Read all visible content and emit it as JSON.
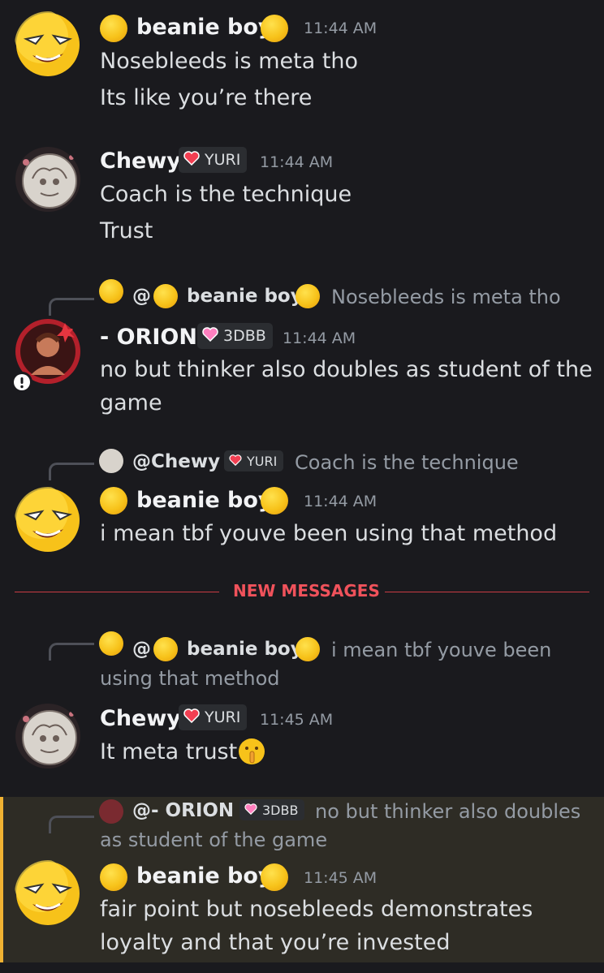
{
  "messages": [
    {
      "author": "beanie boy",
      "time": "11:44 AM",
      "lines": [
        "Nosebleeds is meta tho",
        "Its like you’re there"
      ]
    },
    {
      "author": "Chewy",
      "tag": "YURI",
      "time": "11:44 AM",
      "lines": [
        "Coach is the technique",
        "Trust"
      ]
    },
    {
      "reply": {
        "mention": "@",
        "name": "beanie boy",
        "text": "Nosebleeds is meta tho"
      },
      "author": "- ORION",
      "tag": "3DBB",
      "time": "11:44 AM",
      "lines": [
        "no but thinker also doubles as student of the",
        "game"
      ]
    },
    {
      "reply": {
        "mention": "@Chewy",
        "tag": "YURI",
        "text": "Coach is the technique"
      },
      "author": "beanie boy",
      "time": "11:44 AM",
      "lines": [
        "i mean tbf youve been using that method"
      ]
    },
    {
      "reply": {
        "mention": "@",
        "name": "beanie boy",
        "text_line1": "i mean tbf youve been",
        "text_line2": "using that method"
      },
      "author": "Chewy",
      "tag": "YURI",
      "time": "11:45 AM",
      "lines": [
        "It meta trust"
      ]
    },
    {
      "reply": {
        "mention": "@- ORION",
        "tag": "3DBB",
        "text_line1": "no but thinker also doubles",
        "text_line2": "as student of the game"
      },
      "author": "beanie boy",
      "time": "11:45 AM",
      "lines": [
        "fair point but nosebleeds demonstrates",
        "loyalty and that you’re invested"
      ]
    }
  ],
  "divider": {
    "label": "NEW MESSAGES"
  },
  "colors": {
    "background": "#1a1a1e",
    "mention_highlight": "#2e2c25",
    "highlight_bar": "#f0b232",
    "new_messages": "#f0525b",
    "timestamp": "#949ba4"
  },
  "icons": [
    "drooling-face-emoji",
    "heart-badge-icon",
    "shushing-face-emoji",
    "alert-badge-icon"
  ]
}
